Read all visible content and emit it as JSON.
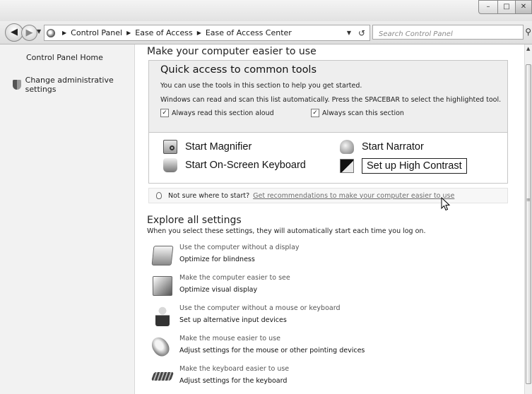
{
  "window": {
    "buttons": {
      "minimize": "–",
      "maximize": "□",
      "close": "✕"
    }
  },
  "nav": {
    "back_icon": "back-arrow-icon",
    "forward_icon": "forward-arrow-icon",
    "breadcrumb": [
      "Control Panel",
      "Ease of Access",
      "Ease of Access Center"
    ],
    "search_placeholder": "Search Control Panel"
  },
  "sidebar": {
    "home": "Control Panel Home",
    "admin": "Change administrative settings"
  },
  "main": {
    "heading": "Make your computer easier to use",
    "quick_access": {
      "title": "Quick access to common tools",
      "line1": "You can use the tools in this section to help you get started.",
      "line2": "Windows can read and scan this list automatically.  Press the SPACEBAR to select the highlighted tool.",
      "checkbox1": "Always read this section aloud",
      "checkbox2": "Always scan this section",
      "checkbox1_checked": true,
      "checkbox2_checked": true
    },
    "tools": {
      "magnifier": "Start Magnifier",
      "narrator": "Start Narrator",
      "keyboard": "Start On-Screen Keyboard",
      "contrast": "Set up High Contrast"
    },
    "tip": {
      "question": "Not sure where to start?",
      "link": "Get recommendations to make your computer easier to use"
    },
    "explore": {
      "heading": "Explore all settings",
      "subtitle": "When you select these settings, they will automatically start each time you log on.",
      "items": [
        {
          "title": "Use the computer without a display",
          "link": "Optimize for blindness",
          "icon": "display-icon"
        },
        {
          "title": "Make the computer easier to see",
          "link": "Optimize visual display",
          "icon": "monitor-magnifier-icon"
        },
        {
          "title": "Use the computer without a mouse or keyboard",
          "link": "Set up alternative input devices",
          "icon": "person-icon"
        },
        {
          "title": "Make the mouse easier to use",
          "link": "Adjust settings for the mouse or other pointing devices",
          "icon": "mouse-icon"
        },
        {
          "title": "Make the keyboard easier to use",
          "link": "Adjust settings for the keyboard",
          "icon": "keyboard-icon"
        }
      ]
    }
  }
}
